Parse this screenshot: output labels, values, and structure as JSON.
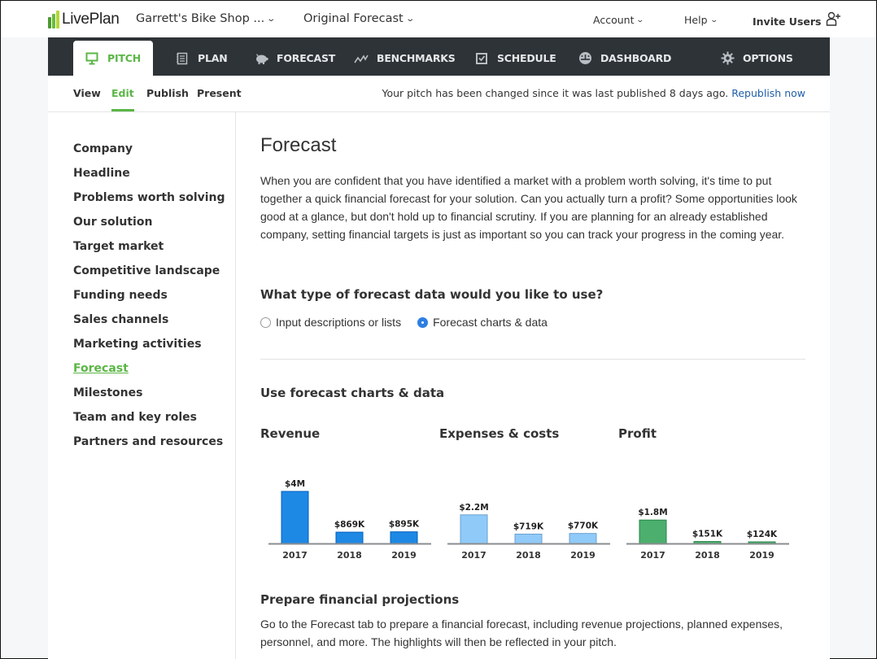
{
  "topbar": {
    "logo_text": "LivePlan",
    "business_name": "Garrett's Bike Shop ...",
    "forecast_name": "Original Forecast",
    "account": "Account",
    "help": "Help",
    "invite_users": "Invite Users",
    "chevron": "⌄"
  },
  "nav": {
    "items": [
      {
        "label": "PITCH",
        "icon": "monitor-icon",
        "active": true
      },
      {
        "label": "PLAN",
        "icon": "document-list-icon"
      },
      {
        "label": "FORECAST",
        "icon": "piggy-bank-icon"
      },
      {
        "label": "BENCHMARKS",
        "icon": "trend-line-icon"
      },
      {
        "label": "SCHEDULE",
        "icon": "checkbox-calendar-icon"
      },
      {
        "label": "DASHBOARD",
        "icon": "gauge-icon"
      },
      {
        "label": "OPTIONS",
        "icon": "gear-icon"
      }
    ]
  },
  "subnav": {
    "tabs": [
      "View",
      "Edit",
      "Publish",
      "Present"
    ],
    "active": "Edit",
    "notice": "Your pitch has been changed since it was last published 8 days ago.",
    "republish_link": "Republish now"
  },
  "sidebar": {
    "items": [
      "Company",
      "Headline",
      "Problems worth solving",
      "Our solution",
      "Target market",
      "Competitive landscape",
      "Funding needs",
      "Sales channels",
      "Marketing activities",
      "Forecast",
      "Milestones",
      "Team and key roles",
      "Partners and resources"
    ],
    "active": "Forecast"
  },
  "main": {
    "title": "Forecast",
    "intro": "When you are confident that you have identified a market with a problem worth solving, it's time to put together a quick financial forecast for your solution. Can you actually turn a profit? Some opportunities look good at a glance, but don't hold up to financial scrutiny. If you are planning for an already established company, setting financial targets is just as important so you can track your progress in the coming year.",
    "question": "What type of forecast data would you like to use?",
    "options": [
      {
        "label": "Input descriptions or lists",
        "selected": false
      },
      {
        "label": "Forecast charts & data",
        "selected": true
      }
    ],
    "charts_heading": "Use forecast charts & data",
    "prepare_heading": "Prepare financial projections",
    "prepare_text": "Go to the Forecast tab to prepare a financial forecast, including revenue projections, planned expenses, personnel, and more. The highlights will then be reflected in your pitch."
  },
  "chart_data": [
    {
      "type": "bar",
      "title": "Revenue",
      "categories": [
        "2017",
        "2018",
        "2019"
      ],
      "values": [
        4000000,
        869000,
        895000
      ],
      "labels": [
        "$4M",
        "$869K",
        "$895K"
      ],
      "color": "#1e88e5",
      "xlabel": "",
      "ylabel": ""
    },
    {
      "type": "bar",
      "title": "Expenses & costs",
      "categories": [
        "2017",
        "2018",
        "2019"
      ],
      "values": [
        2200000,
        719000,
        770000
      ],
      "labels": [
        "$2.2M",
        "$719K",
        "$770K"
      ],
      "color": "#90caf9",
      "xlabel": "",
      "ylabel": ""
    },
    {
      "type": "bar",
      "title": "Profit",
      "categories": [
        "2017",
        "2018",
        "2019"
      ],
      "values": [
        1800000,
        151000,
        124000
      ],
      "labels": [
        "$1.8M",
        "$151K",
        "$124K"
      ],
      "color": "#4caf6e",
      "xlabel": "",
      "ylabel": ""
    }
  ]
}
